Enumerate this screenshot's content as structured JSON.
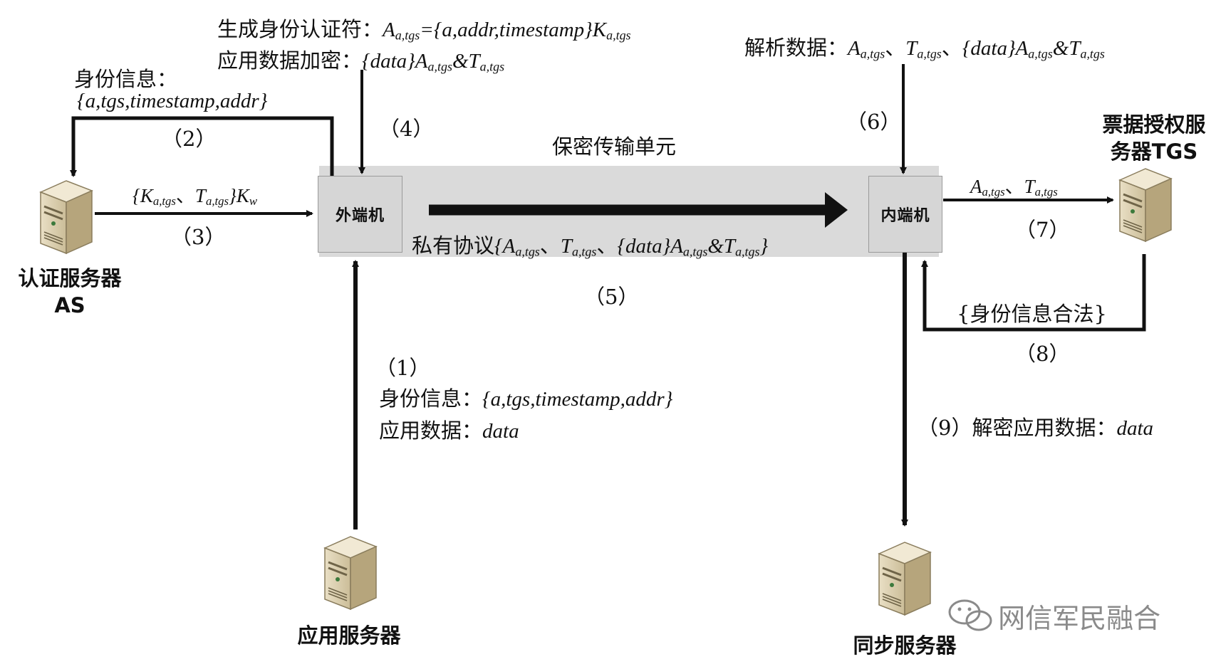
{
  "diagram": {
    "unit_title": "保密传输单元",
    "outer_machine": "外端机",
    "inner_machine": "内端机",
    "servers": {
      "as_line1": "认证服务器",
      "as_line2": "AS",
      "tgs_line1": "票据授权服",
      "tgs_line2": "务器TGS",
      "app": "应用服务器",
      "sync": "同步服务器"
    },
    "steps": {
      "s1": "（1）",
      "s2": "（2）",
      "s3": "（3）",
      "s4": "（4）",
      "s5": "（5）",
      "s6": "（6）",
      "s7": "（7）",
      "s8": "（8）"
    },
    "labels": {
      "gen_auth_prefix": "生成身份认证符：",
      "gen_auth_formula": "{a,addr,timestamp}",
      "app_encrypt_prefix": "应用数据加密：",
      "app_encrypt_formula": "{data}",
      "parse_prefix": "解析数据：",
      "parse_sep": "、",
      "identity_prefix": "身份信息：",
      "identity_tuple": "{a,tgs,timestamp,addr}",
      "app_data_prefix": "应用数据：",
      "app_data_value": "data",
      "private_protocol": "私有协议",
      "identity_valid": "{身份信息合法}",
      "decrypt_prefix": "（9）解密应用数据：",
      "decrypt_value": "data",
      "A": "A",
      "T": "T",
      "K": "K",
      "sub_atgs": "a,tgs",
      "sub_w": "w",
      "amp": "&",
      "eq": "=",
      "lbrace": "{",
      "rbrace": "}",
      "data_brace": "{data}"
    },
    "watermark": "网信军民融合"
  }
}
